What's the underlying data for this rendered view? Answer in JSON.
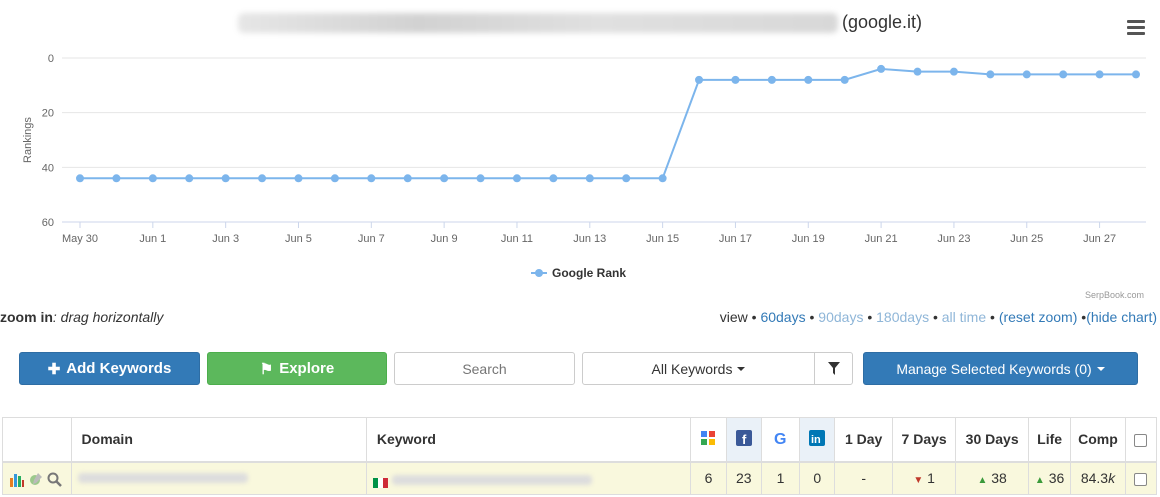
{
  "chart": {
    "title_suffix": "(google.it)",
    "menu_icon": "hamburger-icon",
    "credit": "SerpBook.com"
  },
  "chart_data": {
    "type": "line",
    "ylabel": "Rankings",
    "y_reversed": true,
    "ylim": [
      0,
      60
    ],
    "yticks": [
      "0",
      "20",
      "40",
      "60"
    ],
    "x_tick_labels": [
      "May 30",
      "Jun 1",
      "Jun 3",
      "Jun 5",
      "Jun 7",
      "Jun 9",
      "Jun 11",
      "Jun 13",
      "Jun 15",
      "Jun 17",
      "Jun 19",
      "Jun 21",
      "Jun 23",
      "Jun 25",
      "Jun 27"
    ],
    "x": [
      "May 30",
      "May 31",
      "Jun 1",
      "Jun 2",
      "Jun 3",
      "Jun 4",
      "Jun 5",
      "Jun 6",
      "Jun 7",
      "Jun 8",
      "Jun 9",
      "Jun 10",
      "Jun 11",
      "Jun 12",
      "Jun 13",
      "Jun 14",
      "Jun 15",
      "Jun 16",
      "Jun 17",
      "Jun 18",
      "Jun 19",
      "Jun 20",
      "Jun 21",
      "Jun 22",
      "Jun 23",
      "Jun 24",
      "Jun 25",
      "Jun 26",
      "Jun 27",
      "Jun 28"
    ],
    "series": [
      {
        "name": "Google Rank",
        "color": "#7cb5ec",
        "values": [
          44,
          44,
          44,
          44,
          44,
          44,
          44,
          44,
          44,
          44,
          44,
          44,
          44,
          44,
          44,
          44,
          44,
          8,
          8,
          8,
          8,
          8,
          4,
          5,
          5,
          6,
          6,
          6,
          6,
          6
        ]
      }
    ],
    "grid": true,
    "legend": "bottom-center"
  },
  "controls": {
    "zoom_label": "zoom in",
    "zoom_hint": ": drag horizontally",
    "view_label": "view",
    "view_60": "60days",
    "view_90": "90days",
    "view_180": "180days",
    "view_all": "all time",
    "reset_zoom": "(reset zoom)",
    "hide_chart": "(hide chart)",
    "add_keywords": "Add Keywords",
    "explore": "Explore",
    "search_placeholder": "Search",
    "keywords_filter": "All Keywords",
    "manage_selected": "Manage Selected Keywords (0)"
  },
  "table": {
    "headers": {
      "domain": "Domain",
      "keyword": "Keyword",
      "day1": "1 Day",
      "days7": "7 Days",
      "days30": "30 Days",
      "life": "Life",
      "comp": "Comp"
    },
    "row": {
      "google_rank": "6",
      "facebook": "23",
      "google_plus": "1",
      "linkedin": "0",
      "day1": "-",
      "days7": "1",
      "days30": "38",
      "life": "36",
      "comp": "84.3",
      "comp_suffix": "k"
    }
  }
}
